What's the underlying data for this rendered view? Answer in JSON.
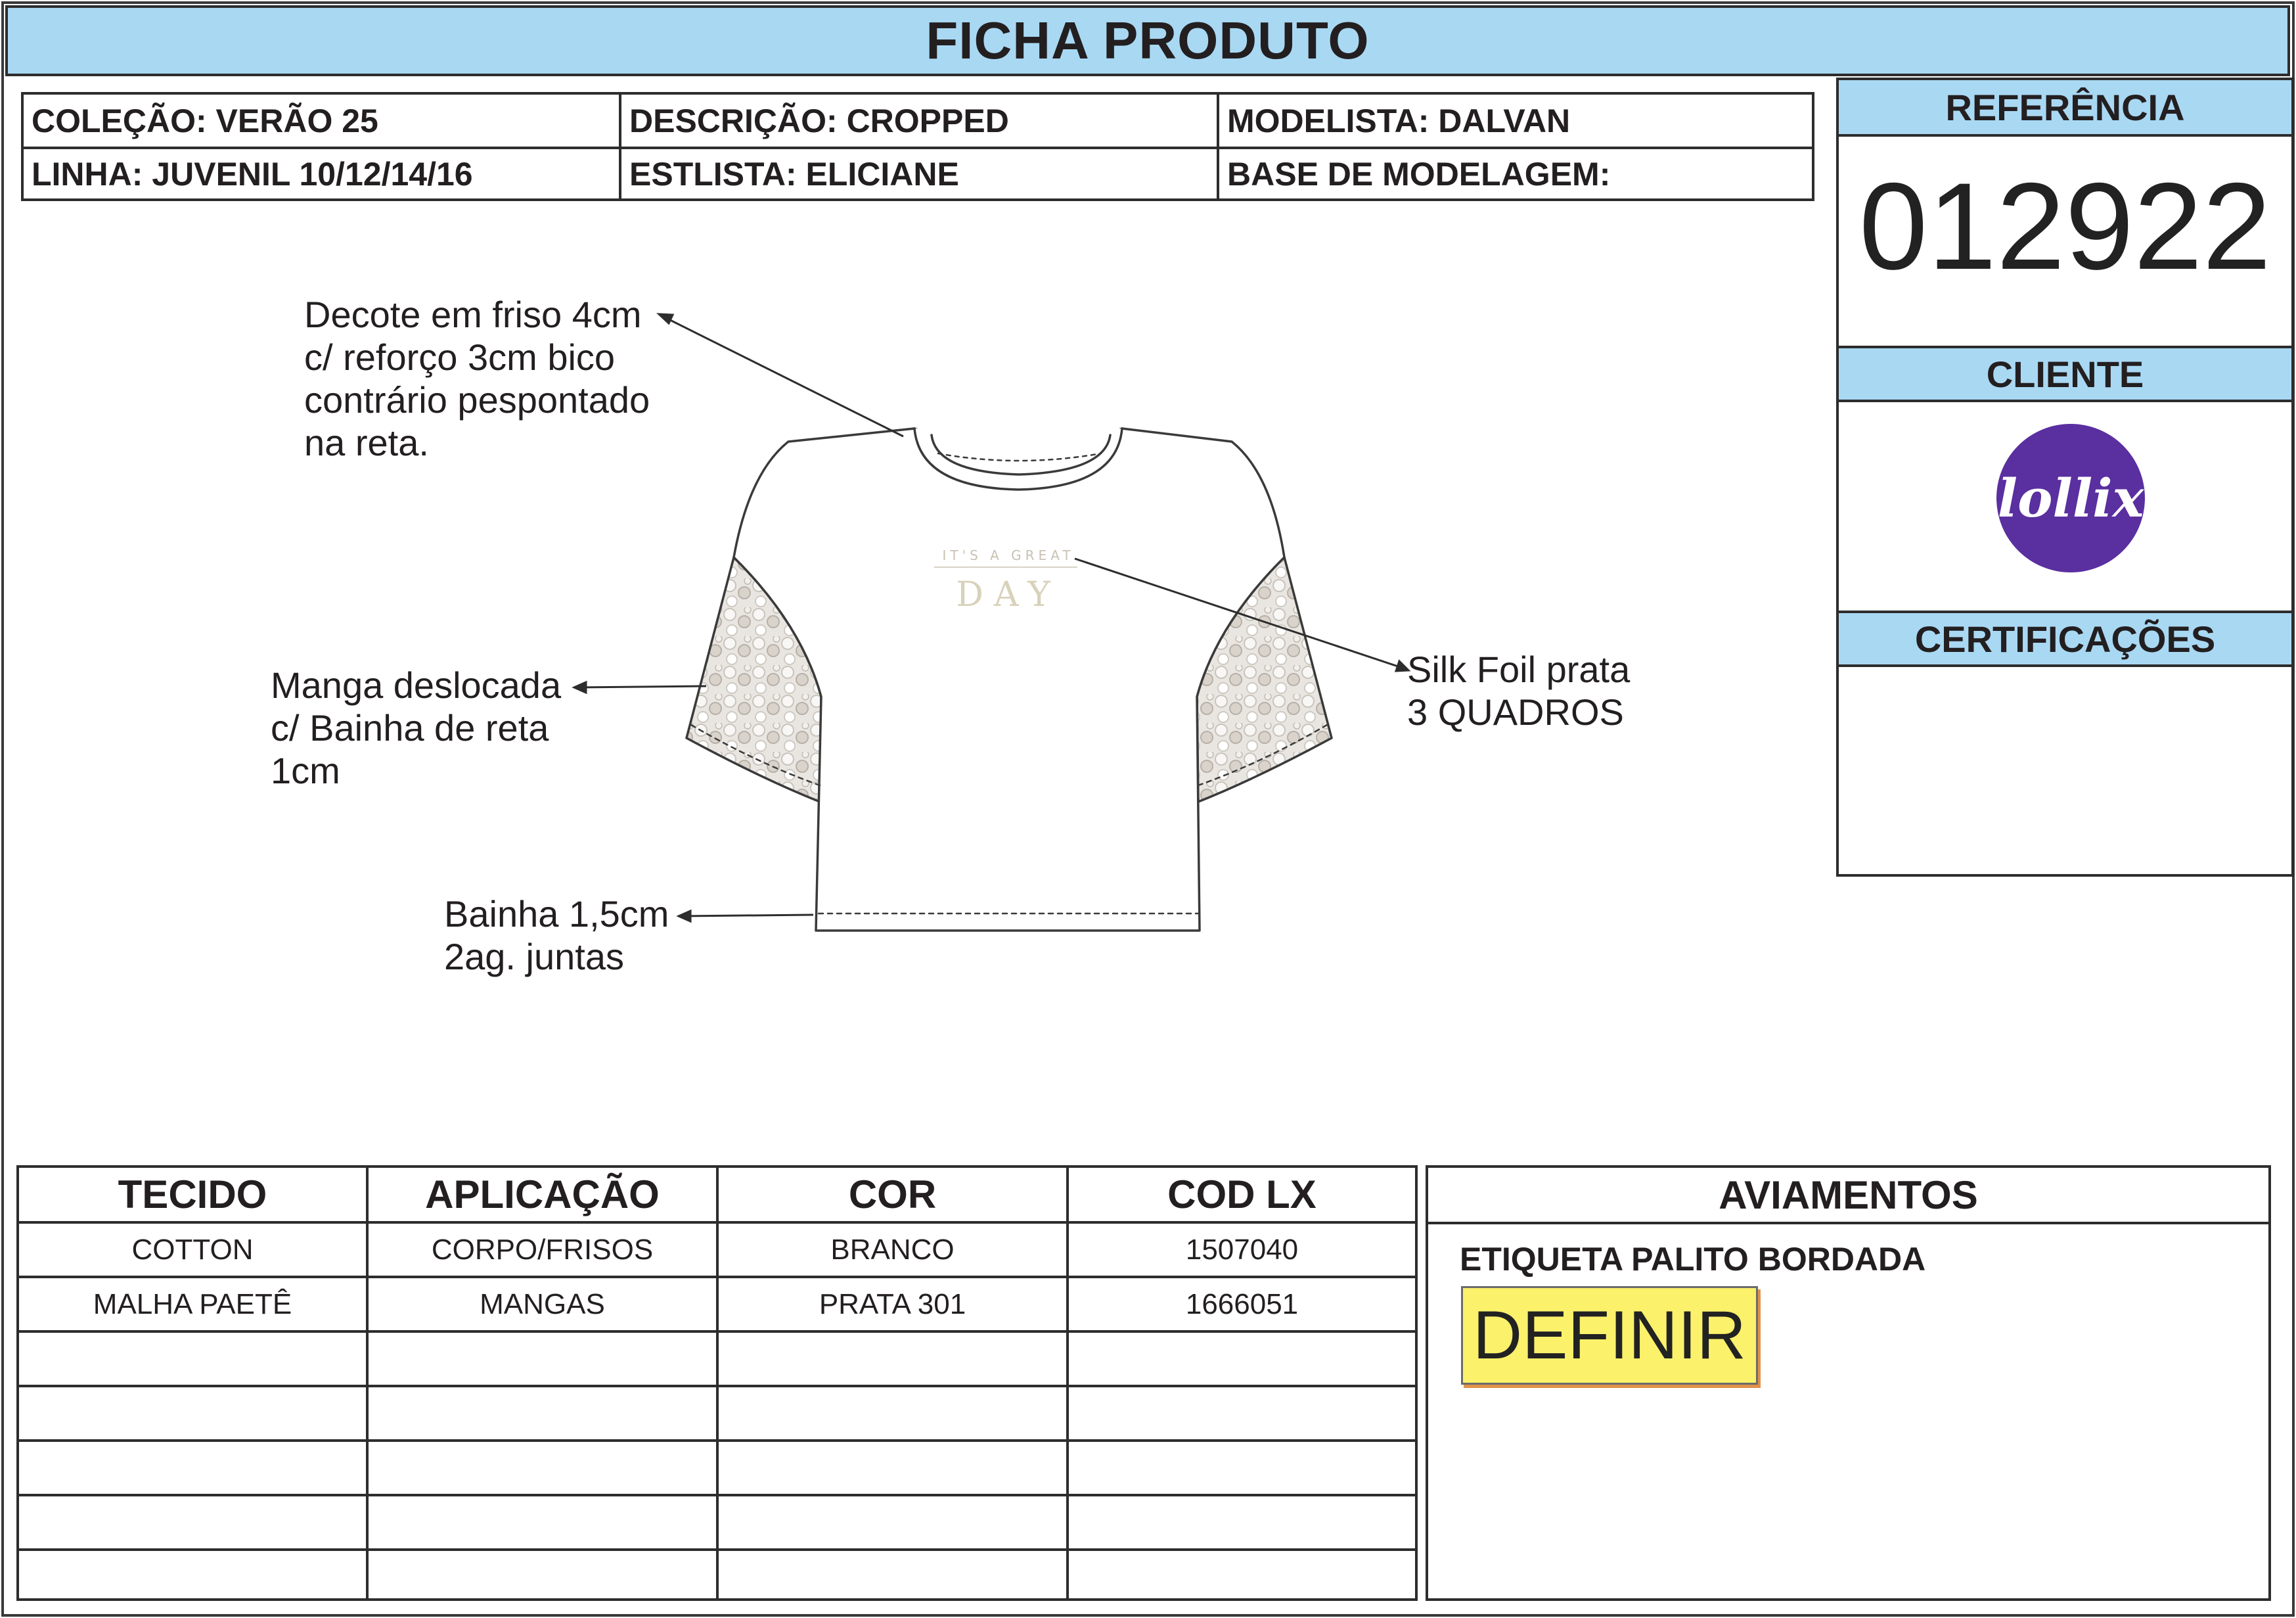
{
  "title": "FICHA PRODUTO",
  "info": {
    "colecao": "COLEÇÃO: VERÃO 25",
    "linha": "LINHA: JUVENIL 10/12/14/16",
    "descricao": "DESCRIÇÃO: CROPPED",
    "estilista": "ESTLISTA: ELICIANE",
    "modelista": "MODELISTA: DALVAN",
    "base": "BASE DE MODELAGEM:"
  },
  "panel": {
    "referencia_label": "REFERÊNCIA",
    "referencia_value": "012922",
    "cliente_label": "CLIENTE",
    "logo_text": "lollix",
    "certificacoes_label": "CERTIFICAÇÕES"
  },
  "annotations": {
    "decote": [
      "Decote em friso 4cm",
      "c/ reforço 3cm bico",
      "contrário pespontado",
      "na reta."
    ],
    "manga": [
      "Manga deslocada",
      "c/ Bainha de reta",
      "1cm"
    ],
    "bainha": [
      "Bainha 1,5cm",
      "2ag. juntas"
    ],
    "silk": [
      "Silk Foil prata",
      "3 QUADROS"
    ]
  },
  "garment_print": {
    "line1": "IT'S A GREAT",
    "line2": "DAY"
  },
  "colors": {
    "header_blue": "#a9d8f3",
    "logo_purple": "#5a2fa0",
    "highlight_yellow": "#fbf16b"
  },
  "materials": {
    "headers": [
      "TECIDO",
      "APLICAÇÃO",
      "COR",
      "COD LX"
    ],
    "rows": [
      [
        "COTTON",
        "CORPO/FRISOS",
        "BRANCO",
        "1507040"
      ],
      [
        "MALHA PAETÊ",
        "MANGAS",
        "PRATA 301",
        "1666051"
      ]
    ]
  },
  "aviamentos": {
    "title": "AVIAMENTOS",
    "items": [
      "ETIQUETA PALITO BORDADA"
    ],
    "pending_label": "DEFINIR"
  }
}
